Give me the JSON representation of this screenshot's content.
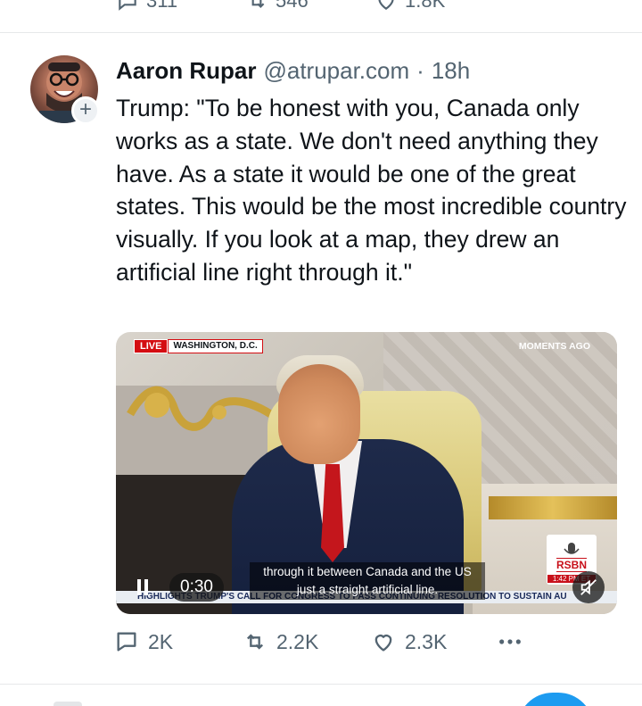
{
  "previous_tweet": {
    "reply_count": "311",
    "repost_count": "546",
    "like_count": "1.8K"
  },
  "tweet": {
    "author_name": "Aaron Rupar",
    "handle": "@atrupar.com",
    "separator": "·",
    "time": "18h",
    "text": "Trump: \"To be honest with you, Canada only works as a state. We don't need anything they have. As a state it would be one of the great states. This would be the most incredible country visually. If you look at a map, they drew an artificial line right through it.\"",
    "follow_badge": "+"
  },
  "video": {
    "live_label": "LIVE",
    "location_label": "WASHINGTON, D.C.",
    "moments_label": "MOMENTS AGO",
    "caption": "through it between Canada and the US just a straight artificial line.",
    "ticker": "HIGHLIGHTS TRUMP'S CALL FOR CONGRESS TO PASS CONTINUING RESOLUTION TO SUSTAIN AU",
    "network_logo": "RSBN",
    "network_time": "1:42 PM ET",
    "elapsed_time": "0:30",
    "playing": true,
    "muted": true
  },
  "actions": {
    "replies": "2K",
    "reposts": "2.2K",
    "likes": "2.3K"
  },
  "colors": {
    "text_primary": "#0f1419",
    "text_secondary": "#536471",
    "accent": "#1d9bf0",
    "live_red": "#d40d12"
  },
  "icons": [
    "comment-icon",
    "repost-icon",
    "heart-icon",
    "more-icon",
    "pause-icon",
    "mute-icon",
    "plus-icon"
  ]
}
